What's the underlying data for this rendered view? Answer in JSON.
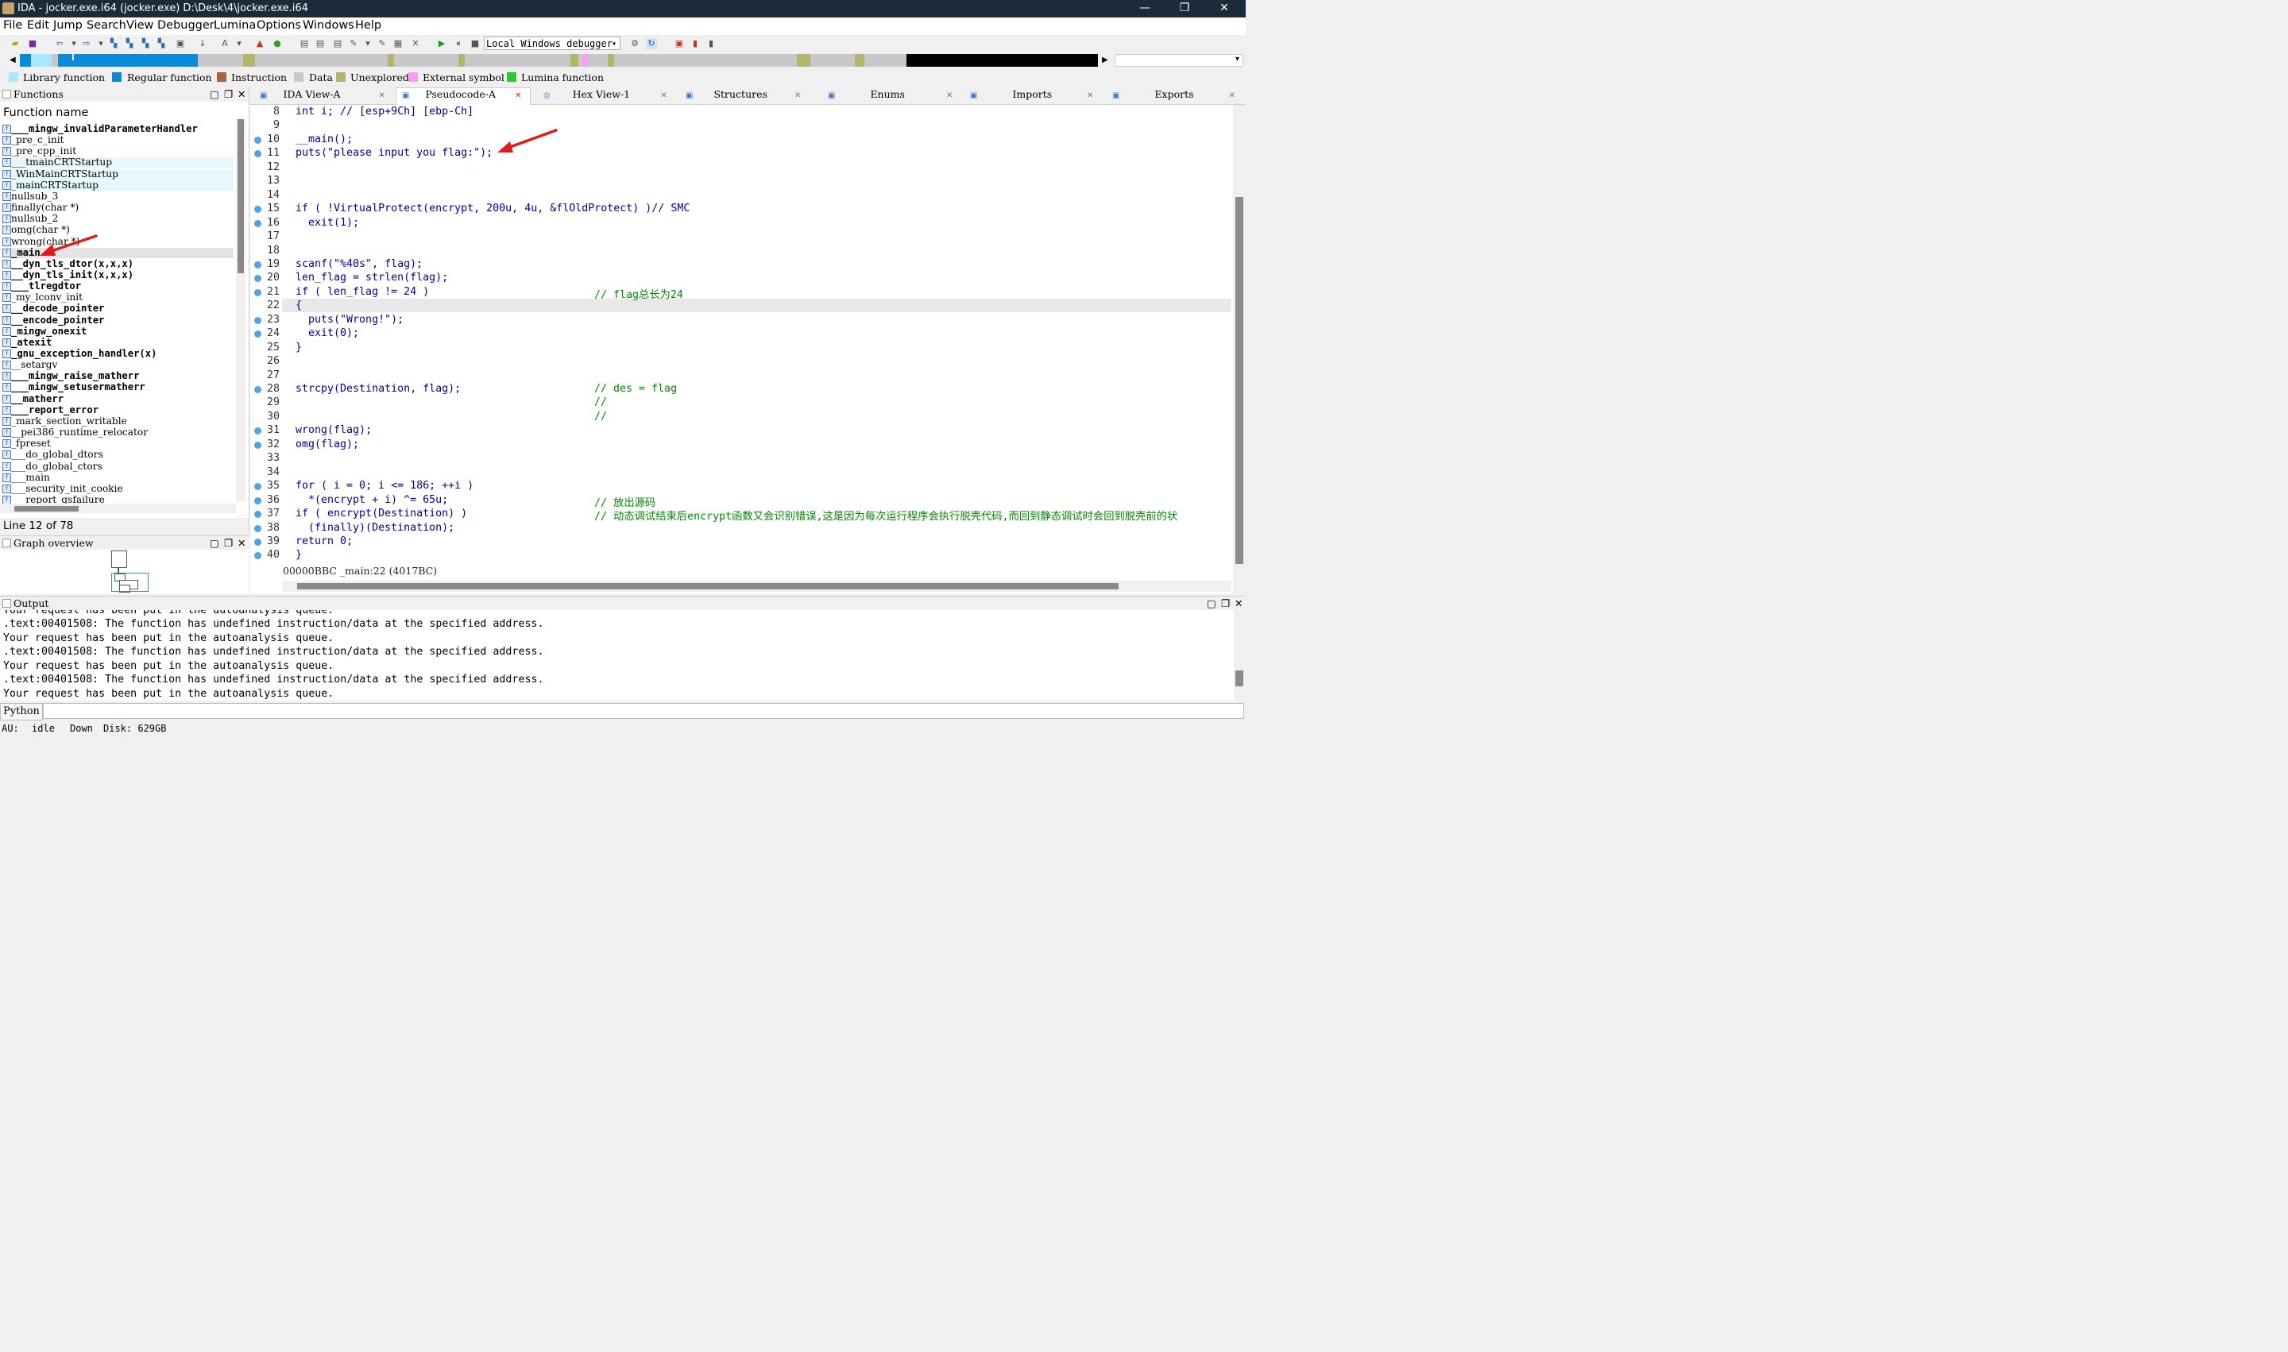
{
  "window": {
    "title": "IDA - jocker.exe.i64 (jocker.exe) D:\\Desk\\4\\jocker.exe.i64",
    "minimize": "—",
    "restore": "❐",
    "close": "✕"
  },
  "menu": [
    "File",
    "Edit",
    "Jump",
    "Search",
    "View",
    "Debugger",
    "Lumina",
    "Options",
    "Windows",
    "Help"
  ],
  "toolbar": {
    "debugger_select": "Local Windows debugger"
  },
  "legend": [
    {
      "label": "Library function",
      "color": "#a8e8ff"
    },
    {
      "label": "Regular function",
      "color": "#0a8ad8"
    },
    {
      "label": "Instruction",
      "color": "#a86440"
    },
    {
      "label": "Data",
      "color": "#c8c8c8"
    },
    {
      "label": "Unexplored",
      "color": "#b4b46c"
    },
    {
      "label": "External symbol",
      "color": "#ff9cf4"
    },
    {
      "label": "Lumina function",
      "color": "#2ec82e"
    }
  ],
  "functions": {
    "title": "Functions",
    "column": "Function name",
    "items": [
      "___mingw_invalidParameterHandler",
      "_pre_c_init",
      "_pre_cpp_init",
      "___tmainCRTStartup",
      "_WinMainCRTStartup",
      "_mainCRTStartup",
      "nullsub_3",
      "finally(char *)",
      "nullsub_2",
      "omg(char *)",
      "wrong(char *)",
      "_main",
      "__dyn_tls_dtor(x,x,x)",
      "__dyn_tls_init(x,x,x)",
      "___tlregdtor",
      "_my_lconv_init",
      "__decode_pointer",
      "__encode_pointer",
      "_mingw_onexit",
      "_atexit",
      "_gnu_exception_handler(x)",
      "__setargv",
      "___mingw_raise_matherr",
      "___mingw_setusermatherr",
      "__matherr",
      "___report_error",
      "_mark_section_writable",
      "__pei386_runtime_relocator",
      "_fpreset",
      "___do_global_dtors",
      "___do_global_ctors",
      "___main",
      "___security_init_cookie",
      "___report_gsfailure"
    ],
    "status": "Line 12 of 78"
  },
  "graph_overview": {
    "title": "Graph overview"
  },
  "tabs": [
    "IDA View-A",
    "Pseudocode-A",
    "Hex View-1",
    "Structures",
    "Enums",
    "Imports",
    "Exports"
  ],
  "code": {
    "status": "00000BBC _main:22 (4017BC)",
    "lines": [
      {
        "n": "8",
        "dot": false,
        "text": "int i; // [esp+9Ch] [ebp-Ch]"
      },
      {
        "n": "9",
        "dot": false,
        "text": ""
      },
      {
        "n": "10",
        "dot": true,
        "text": "__main();"
      },
      {
        "n": "11",
        "dot": true,
        "text": "puts(\"please input you flag:\");"
      },
      {
        "n": "12",
        "dot": false,
        "text": ""
      },
      {
        "n": "13",
        "dot": false,
        "text": ""
      },
      {
        "n": "14",
        "dot": false,
        "text": ""
      },
      {
        "n": "15",
        "dot": true,
        "text": "if ( !VirtualProtect(encrypt, 200u, 4u, &flOldProtect) )// SMC"
      },
      {
        "n": "16",
        "dot": true,
        "text": "  exit(1);"
      },
      {
        "n": "17",
        "dot": false,
        "text": ""
      },
      {
        "n": "18",
        "dot": false,
        "text": ""
      },
      {
        "n": "19",
        "dot": true,
        "text": "scanf(\"%40s\", flag);"
      },
      {
        "n": "20",
        "dot": true,
        "text": "len_flag = strlen(flag);"
      },
      {
        "n": "21",
        "dot": true,
        "text": "if ( len_flag != 24 )"
      },
      {
        "n": "22",
        "dot": false,
        "text": "{"
      },
      {
        "n": "23",
        "dot": true,
        "text": "  puts(\"Wrong!\");"
      },
      {
        "n": "24",
        "dot": true,
        "text": "  exit(0);"
      },
      {
        "n": "25",
        "dot": false,
        "text": "}"
      },
      {
        "n": "26",
        "dot": false,
        "text": ""
      },
      {
        "n": "27",
        "dot": false,
        "text": ""
      },
      {
        "n": "28",
        "dot": true,
        "text": "strcpy(Destination, flag);"
      },
      {
        "n": "29",
        "dot": false,
        "text": ""
      },
      {
        "n": "30",
        "dot": false,
        "text": ""
      },
      {
        "n": "31",
        "dot": true,
        "text": "wrong(flag);"
      },
      {
        "n": "32",
        "dot": true,
        "text": "omg(flag);"
      },
      {
        "n": "33",
        "dot": false,
        "text": ""
      },
      {
        "n": "34",
        "dot": false,
        "text": ""
      },
      {
        "n": "35",
        "dot": true,
        "text": "for ( i = 0; i <= 186; ++i )"
      },
      {
        "n": "36",
        "dot": true,
        "text": "  *(encrypt + i) ^= 65u;"
      },
      {
        "n": "37",
        "dot": true,
        "text": "if ( encrypt(Destination) )"
      },
      {
        "n": "38",
        "dot": true,
        "text": "  (finally)(Destination);"
      },
      {
        "n": "39",
        "dot": true,
        "text": "return 0;"
      },
      {
        "n": "40",
        "dot": true,
        "text": "}"
      }
    ],
    "comments": {
      "21": "// flag总长为24",
      "28": "// des = flag",
      "29": "//",
      "30": "//",
      "36": "// 放出源码",
      "37": "// 动态调试结束后encrypt函数又会识别错误,这是因为每次运行程序会执行脱壳代码,而回到静态调试时会回到脱壳前的状"
    }
  },
  "output": {
    "title": "Output",
    "lines": [
      "Your request has been put in the autoanalysis queue.",
      ".text:00401508: The function has undefined instruction/data at the specified address.",
      "Your request has been put in the autoanalysis queue.",
      ".text:00401508: The function has undefined instruction/data at the specified address.",
      "Your request has been put in the autoanalysis queue.",
      ".text:00401508: The function has undefined instruction/data at the specified address.",
      "Your request has been put in the autoanalysis queue."
    ],
    "python_label": "Python"
  },
  "statusbar": {
    "au": "AU:",
    "state": "idle",
    "dir": "Down",
    "disk": "Disk: 629GB"
  }
}
